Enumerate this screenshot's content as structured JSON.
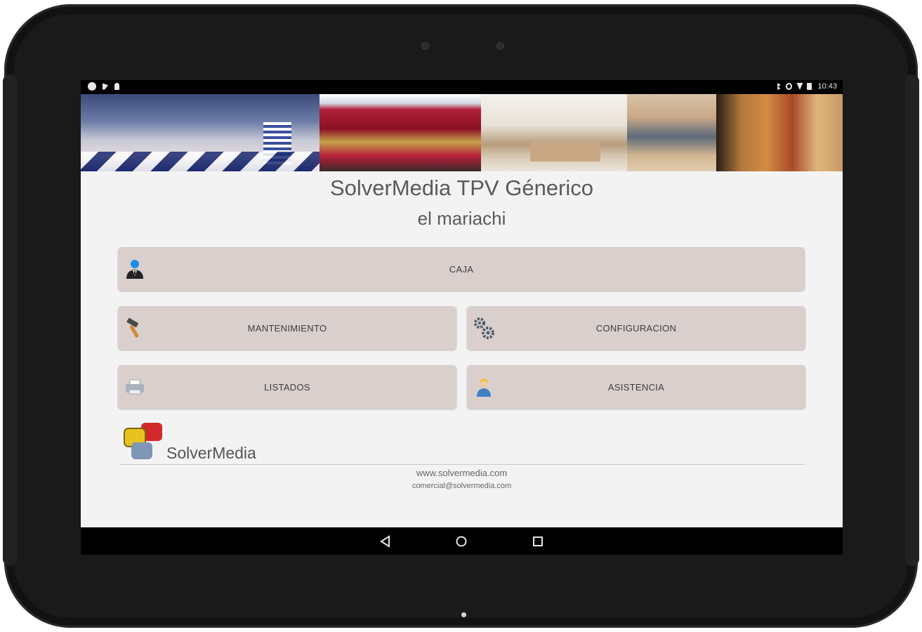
{
  "status_bar": {
    "time": "10:43",
    "left_icons": [
      "circle-icon",
      "notification-icon",
      "location-pin-icon"
    ],
    "right_icons": [
      "bluetooth-icon",
      "alarm-icon",
      "wifi-icon",
      "battery-icon"
    ]
  },
  "header": {
    "title": "SolverMedia TPV Génerico",
    "subtitle": "el mariachi"
  },
  "menu": {
    "caja": {
      "label": "CAJA",
      "icon": "cashier-person-icon"
    },
    "mantenimiento": {
      "label": "MANTENIMIENTO",
      "icon": "hammer-icon"
    },
    "configuracion": {
      "label": "CONFIGURACION",
      "icon": "gears-icon"
    },
    "listados": {
      "label": "LISTADOS",
      "icon": "printer-icon"
    },
    "asistencia": {
      "label": "ASISTENCIA",
      "icon": "support-worker-icon"
    }
  },
  "footer": {
    "brand": "SolverMedia",
    "website": "www.solvermedia.com",
    "email": "comercial@solvermedia.com"
  },
  "navigation": {
    "back": "back-icon",
    "home": "home-icon",
    "recents": "recents-icon"
  },
  "colors": {
    "button_bg": "#d9cfcc",
    "screen_bg": "#f4f3f3",
    "title_text": "#5a5a5a"
  }
}
